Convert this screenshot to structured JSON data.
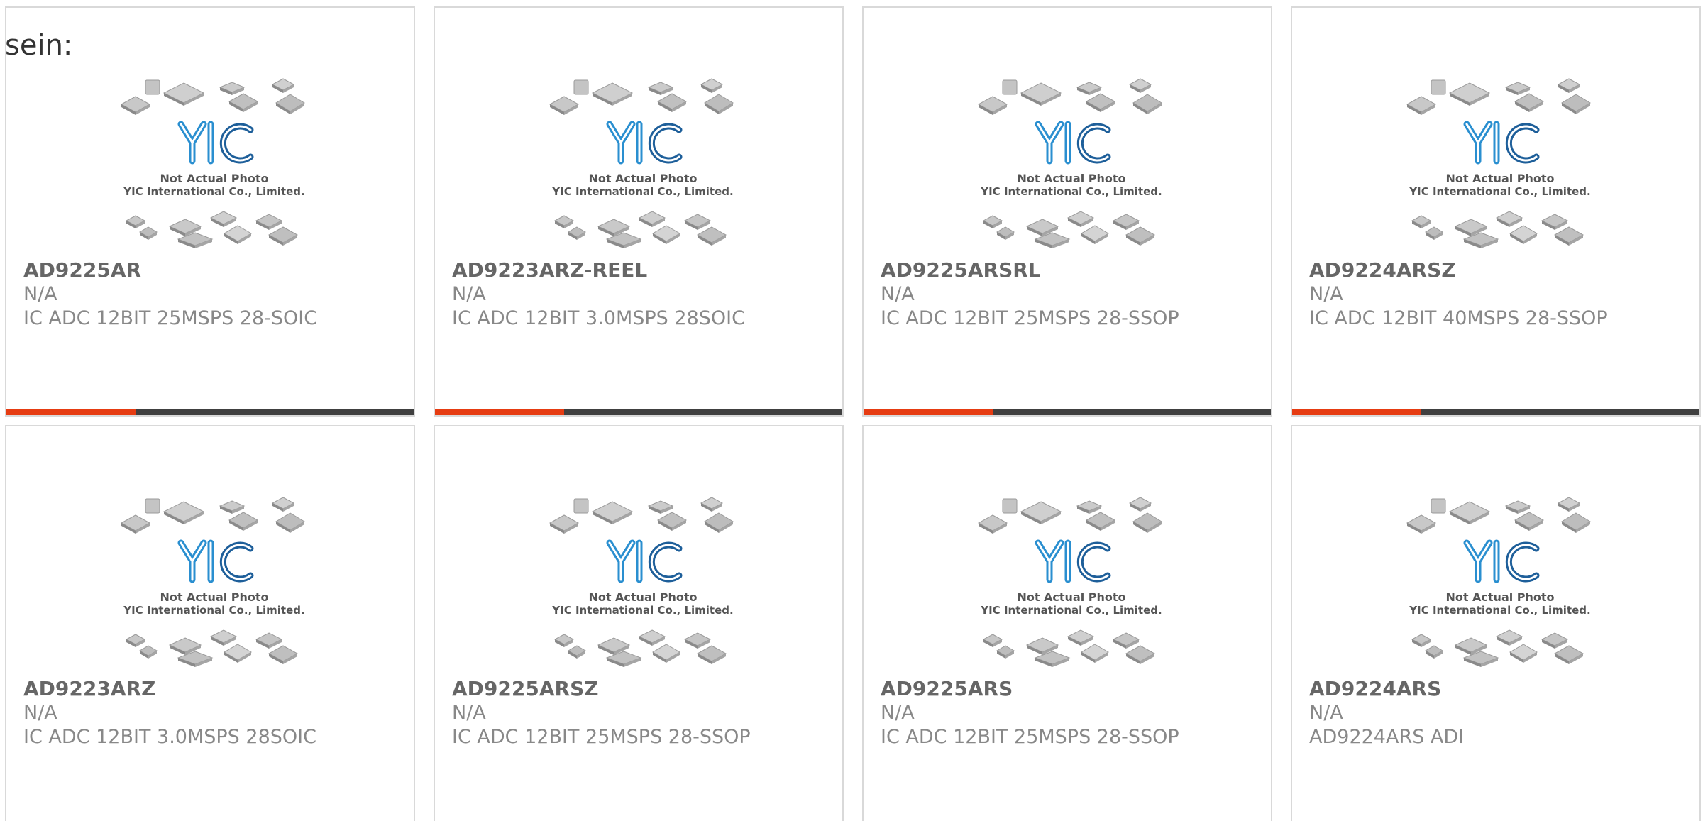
{
  "heading": "sein:",
  "placeholder_caption": {
    "line1": "Not Actual Photo",
    "line2": "YIC International Co., Limited.",
    "logo": "YIC"
  },
  "colors": {
    "accent": "#e63c12",
    "bar": "#404040",
    "logo_blue": "#2a8fd0",
    "logo_dark": "#1e5f9a"
  },
  "products": [
    {
      "part_number": "AD9225AR",
      "manufacturer": "N/A",
      "description": "IC ADC 12BIT 25MSPS 28-SOIC"
    },
    {
      "part_number": "AD9223ARZ-REEL",
      "manufacturer": "N/A",
      "description": "IC ADC 12BIT 3.0MSPS 28SOIC"
    },
    {
      "part_number": "AD9225ARSRL",
      "manufacturer": "N/A",
      "description": "IC ADC 12BIT 25MSPS 28-SSOP"
    },
    {
      "part_number": "AD9224ARSZ",
      "manufacturer": "N/A",
      "description": "IC ADC 12BIT 40MSPS 28-SSOP"
    },
    {
      "part_number": "AD9223ARZ",
      "manufacturer": "N/A",
      "description": "IC ADC 12BIT 3.0MSPS 28SOIC"
    },
    {
      "part_number": "AD9225ARSZ",
      "manufacturer": "N/A",
      "description": "IC ADC 12BIT 25MSPS 28-SSOP"
    },
    {
      "part_number": "AD9225ARS",
      "manufacturer": "N/A",
      "description": "IC ADC 12BIT 25MSPS 28-SSOP"
    },
    {
      "part_number": "AD9224ARS",
      "manufacturer": "N/A",
      "description": "AD9224ARS ADI"
    }
  ]
}
